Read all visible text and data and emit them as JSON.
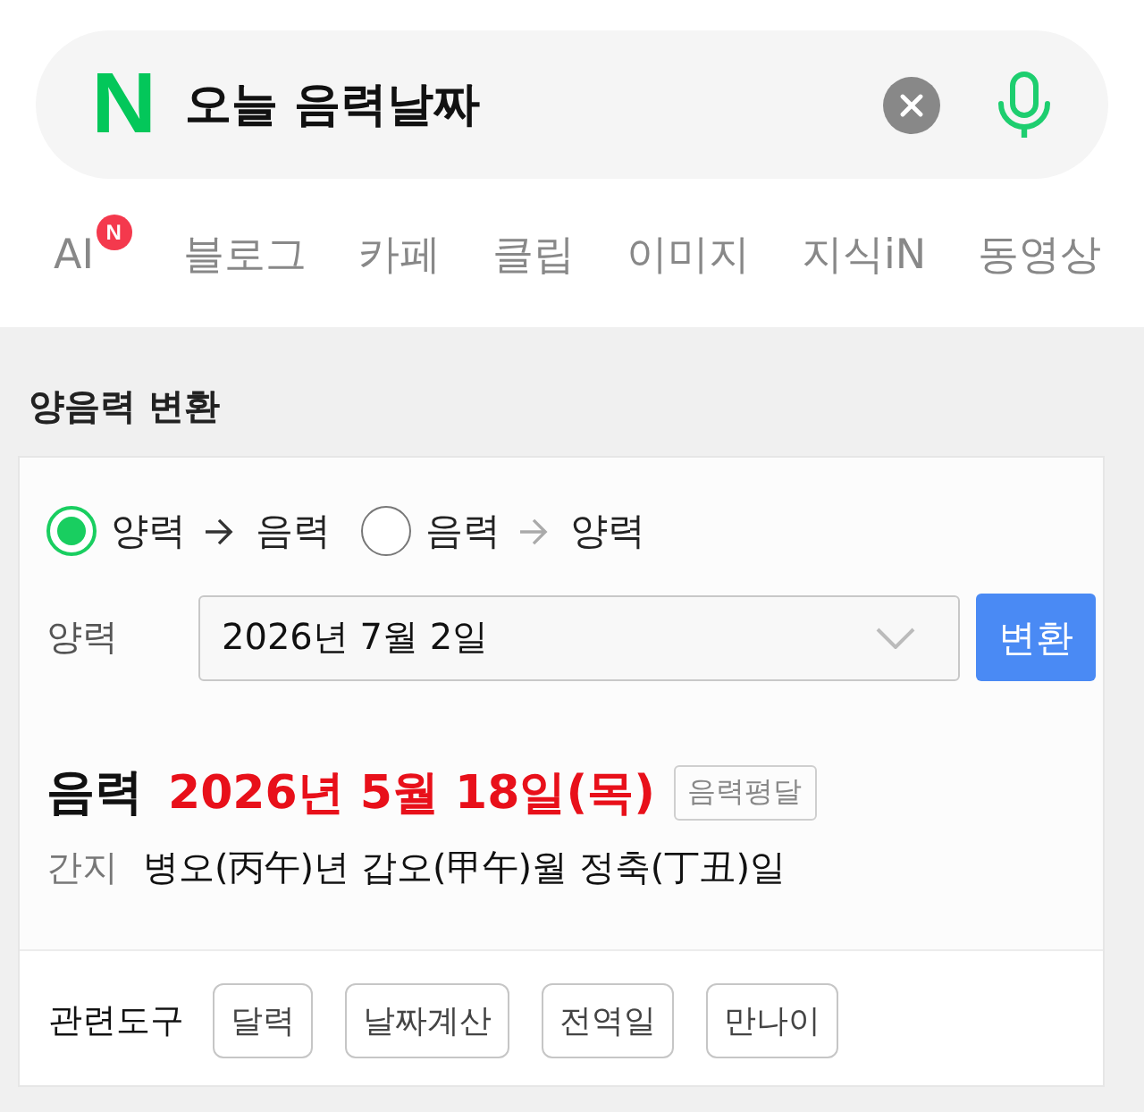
{
  "search": {
    "logo": "N",
    "value": "오늘 음력날짜"
  },
  "tabs": [
    {
      "label": "AI",
      "badge": "N",
      "selected": false
    },
    {
      "label": "블로그",
      "selected": false
    },
    {
      "label": "카페",
      "selected": false
    },
    {
      "label": "클립",
      "selected": false
    },
    {
      "label": "이미지",
      "selected": false
    },
    {
      "label": "지식iN",
      "selected": false
    },
    {
      "label": "동영상",
      "selected": false
    }
  ],
  "converter": {
    "title": "양음력 변환",
    "modes": [
      {
        "from": "양력",
        "to": "음력",
        "selected": true
      },
      {
        "from": "음력",
        "to": "양력",
        "selected": false
      }
    ],
    "date_label": "양력",
    "date_value": "2026년 7월 2일",
    "convert_button": "변환",
    "result": {
      "label": "음력",
      "date": "2026년 5월 18일(목)",
      "badge": "음력평달",
      "ganji_label": "간지",
      "ganji": "병오(丙午)년 갑오(甲午)월 정축(丁丑)일"
    },
    "tools_label": "관련도구",
    "tools": [
      "달력",
      "날짜계산",
      "전역일",
      "만나이"
    ]
  }
}
